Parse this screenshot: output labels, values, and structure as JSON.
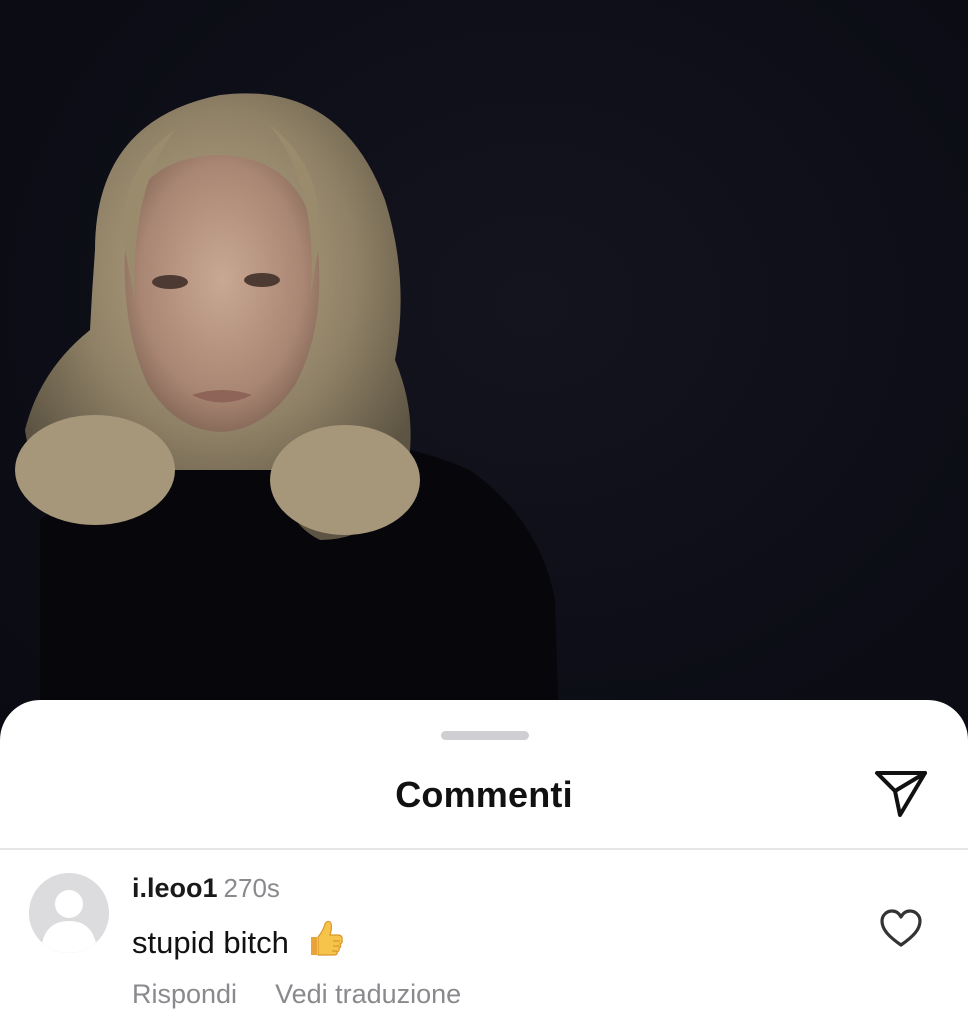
{
  "sheet": {
    "title": "Commenti",
    "share_icon": "paper-plane-icon"
  },
  "comment": {
    "username": "i.leoo1",
    "timestamp": "270s",
    "text": "stupid bitch",
    "emoji_icon": "thumbs-up-emoji",
    "reply_label": "Rispondi",
    "translate_label": "Vedi traduzione",
    "like_icon": "heart-outline-icon"
  },
  "colors": {
    "photo_background": "#0b0c14",
    "sheet_background": "#ffffff",
    "secondary_text": "#8a8a8e"
  }
}
